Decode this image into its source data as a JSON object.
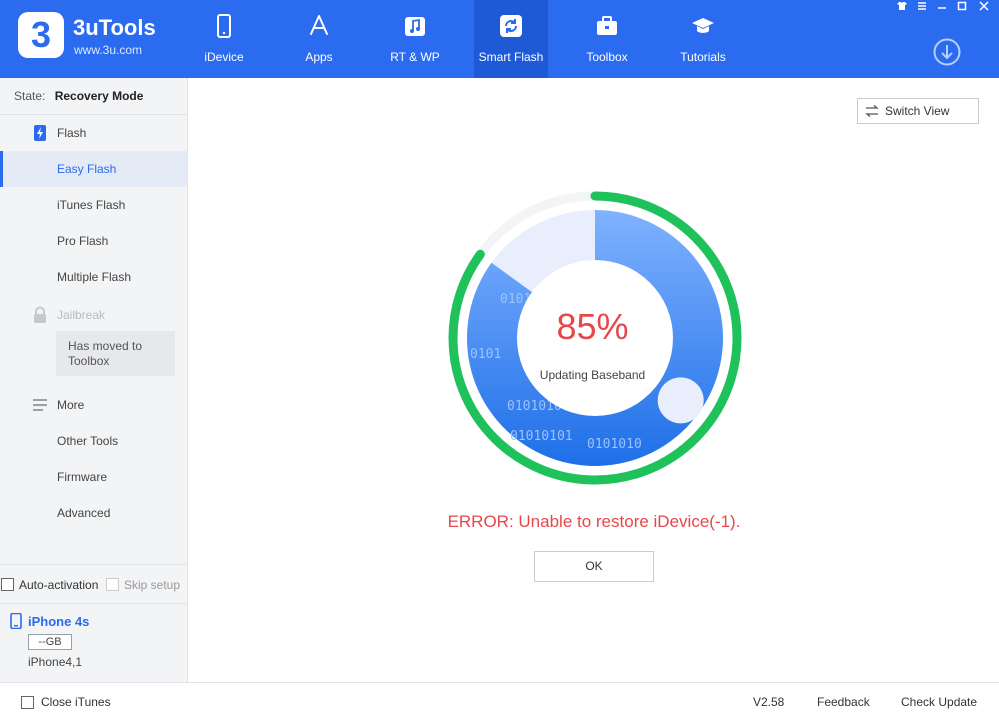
{
  "app": {
    "name": "3uTools",
    "url": "www.3u.com",
    "logo_glyph": "3"
  },
  "nav": {
    "items": [
      {
        "label": "iDevice",
        "icon": "phone-icon"
      },
      {
        "label": "Apps",
        "icon": "app-store-icon"
      },
      {
        "label": "RT & WP",
        "icon": "music-note-icon"
      },
      {
        "label": "Smart Flash",
        "icon": "refresh-icon",
        "active": true
      },
      {
        "label": "Toolbox",
        "icon": "toolbox-icon"
      },
      {
        "label": "Tutorials",
        "icon": "graduation-cap-icon"
      }
    ]
  },
  "window_controls": [
    "shirt-icon",
    "list-icon",
    "minimize-icon",
    "maximize-icon",
    "close-icon"
  ],
  "sidebar": {
    "state_label": "State:",
    "state_value": "Recovery Mode",
    "flash_label": "Flash",
    "items": [
      "Easy Flash",
      "iTunes Flash",
      "Pro Flash",
      "Multiple Flash"
    ],
    "active_item": "Easy Flash",
    "jailbreak_label": "Jailbreak",
    "jailbreak_tooltip_line1": "Has moved to",
    "jailbreak_tooltip_line2": "Toolbox",
    "more_label": "More",
    "more_items": [
      "Other Tools",
      "Firmware",
      "Advanced"
    ],
    "auto_activation_label": "Auto-activation",
    "skip_setup_label": "Skip setup"
  },
  "device": {
    "name": "iPhone 4s",
    "storage": "--GB",
    "model": "iPhone4,1"
  },
  "main": {
    "switch_view_label": "Switch View",
    "progress_text": "85%",
    "progress_fraction": 0.85,
    "status": "Updating Baseband",
    "error": "ERROR: Unable to restore iDevice(-1).",
    "ok_label": "OK",
    "binary_texts": [
      "0101",
      "0101",
      "0101010",
      "01010101",
      "0101010"
    ]
  },
  "footer": {
    "close_itunes_label": "Close iTunes",
    "version": "V2.58",
    "feedback_label": "Feedback",
    "check_update_label": "Check Update"
  },
  "colors": {
    "accent": "#2a6bf0",
    "progress_ring": "#1fc15a",
    "error": "#e8464a",
    "fill_blue": "#2a7cf2"
  }
}
